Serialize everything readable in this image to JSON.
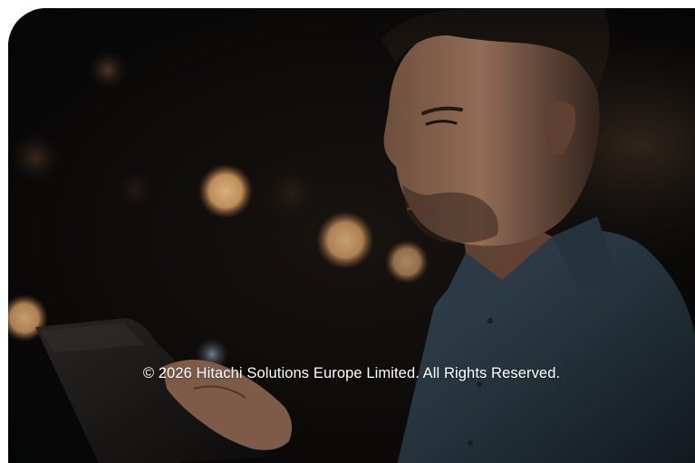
{
  "footer": {
    "copyright": "© 2026 Hitachi Solutions Europe Limited. All Rights Reserved."
  },
  "hero": {
    "image_subject": "man looking at tablet at night"
  },
  "colors": {
    "background": "#07080a",
    "shirt": "#2a3a44",
    "text": "#ffffff"
  }
}
